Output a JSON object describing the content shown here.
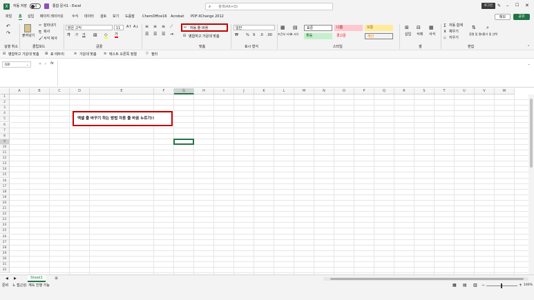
{
  "titlebar": {
    "autosave_label": "자동 저장",
    "autosave_state": "끔",
    "doc_title": "통합 문서1  -  Excel",
    "search_placeholder": "검색(Alt+Q)",
    "signin_label": "로그인"
  },
  "menu": {
    "tabs": [
      "파일",
      "홈",
      "삽입",
      "페이지 레이아웃",
      "수식",
      "데이터",
      "검토",
      "보기",
      "도움말",
      "ChemOffice16",
      "Acrobat",
      "PDF-XChange 2012"
    ],
    "memo_label": "메모",
    "share_label": "공유"
  },
  "ribbon": {
    "undo_group": "실행 취소",
    "clipboard": {
      "paste": "붙여넣기",
      "cut": "잘라내기",
      "copy": "복사",
      "format_painter": "서식 복사",
      "group": "클립보드"
    },
    "font": {
      "name": "맑은 고딕",
      "size": "11",
      "group": "글꼴"
    },
    "align": {
      "wrap": "자동 줄 바꿈",
      "merge": "병합하고 가운데 맞춤",
      "group": "맞춤"
    },
    "number": {
      "format": "일반",
      "group": "표시 형식"
    },
    "styles": {
      "cond_format": "조건부 서식",
      "table_format": "표 서식",
      "normal": "표준",
      "bad": "나쁨",
      "good_label": "보통",
      "neutral": "좋음",
      "warn": "경고문",
      "calc": "계산",
      "group": "스타일"
    },
    "cells": {
      "insert": "삽입",
      "delete": "삭제",
      "format": "서식",
      "group": "셀"
    },
    "edit": {
      "autosum": "자동 합계",
      "fill": "채우기",
      "clear": "지우기",
      "sort": "정렬 및 필터",
      "find": "찾기 및 선택",
      "group": "편집"
    }
  },
  "quickbar": {
    "merge_center": "병합하고 가운데 맞춤",
    "table_border": "표 테두리",
    "center": "가운데 맞춤",
    "text_center": "텍스트 오른쪽 정렬",
    "filter": "필터"
  },
  "formula": {
    "namebox": "G9",
    "fx": "fx",
    "value": ""
  },
  "columns": [
    "A",
    "B",
    "C",
    "D",
    "E",
    "F",
    "G",
    "H",
    "I",
    "J",
    "K",
    "L",
    "M",
    "N",
    "O",
    "P",
    "Q",
    "R",
    "S",
    "T",
    "U",
    "V",
    "W"
  ],
  "rows": [
    "1",
    "2",
    "3",
    "4",
    "5",
    "6",
    "7",
    "8",
    "9",
    "10",
    "11",
    "12",
    "13",
    "14",
    "15",
    "16",
    "17",
    "18",
    "19",
    "20",
    "21",
    "22",
    "23",
    "24",
    "25",
    "26",
    "27",
    "28",
    "29",
    "30",
    "31",
    "32"
  ],
  "selected_cell": "G9",
  "annotation": "엑셀 줄 바꾸기 하는 방법 자동 줄 바꿈 누르기!!",
  "sheets": [
    "Sheet1"
  ],
  "status": {
    "ready": "준비",
    "accessibility": "접근성: 계속 진행 가능",
    "zoom": "100%"
  },
  "colors": {
    "excel_green": "#217346",
    "highlight_red": "#c00000",
    "style_bad_bg": "#ffc7ce",
    "style_good_bg": "#c6efce",
    "style_neutral_bg": "#ffeb9c"
  }
}
